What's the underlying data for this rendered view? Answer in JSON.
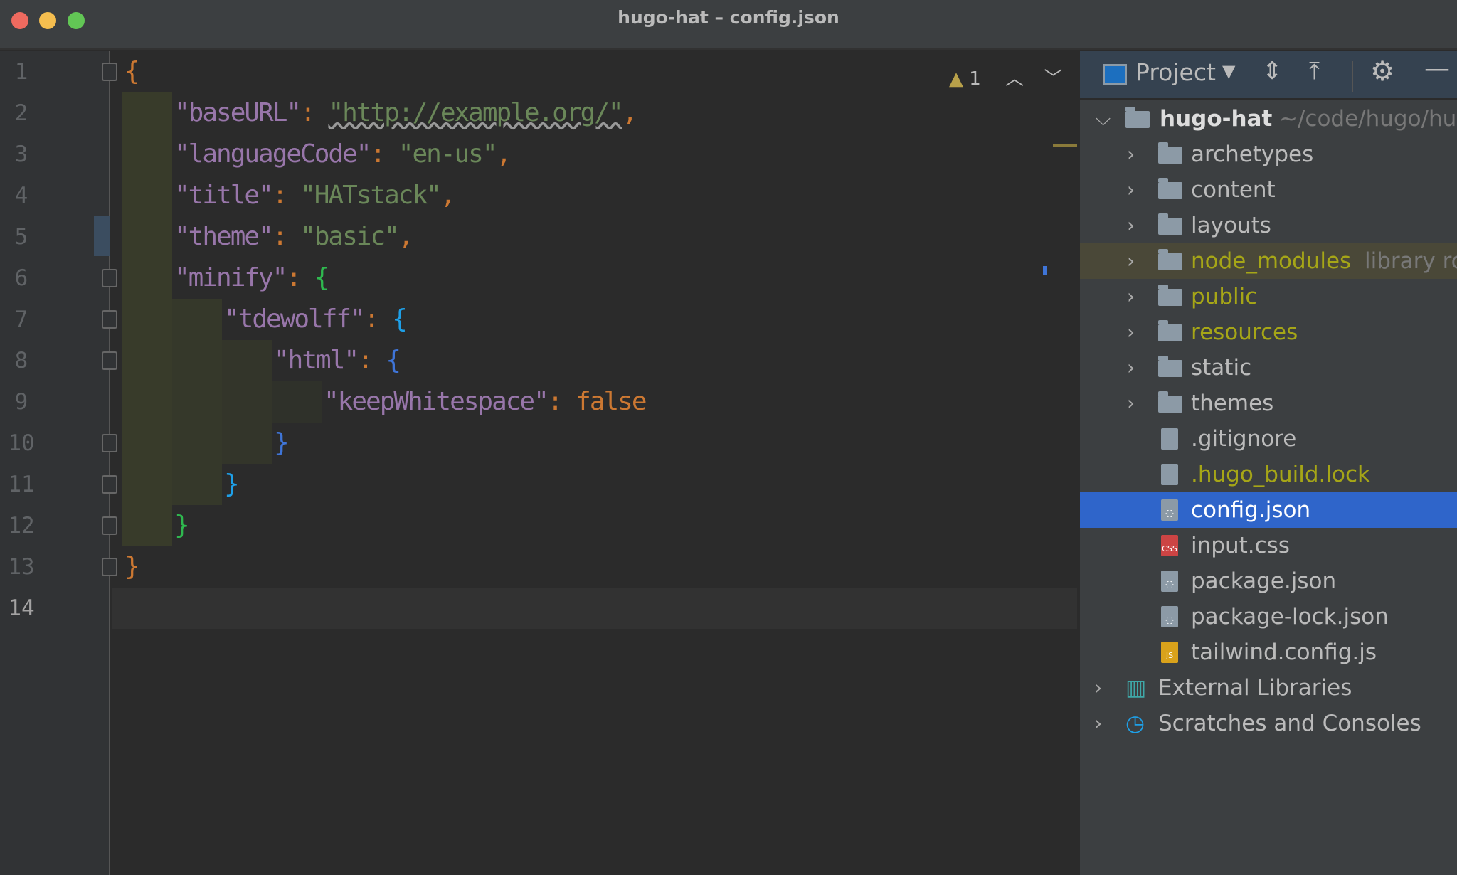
{
  "window": {
    "title": "hugo-hat – config.json"
  },
  "editor": {
    "warnings": "1",
    "lines": [
      {
        "n": "1",
        "parts": [
          [
            "b",
            "{"
          ]
        ]
      },
      {
        "n": "2",
        "parts": [
          [
            "k",
            "\"baseURL\""
          ],
          [
            "p",
            ": "
          ],
          [
            "s",
            "\"http://example.org/\""
          ],
          [
            "p",
            ","
          ]
        ]
      },
      {
        "n": "3",
        "parts": [
          [
            "k",
            "\"languageCode\""
          ],
          [
            "p",
            ": "
          ],
          [
            "s",
            "\"en-us\""
          ],
          [
            "p",
            ","
          ]
        ]
      },
      {
        "n": "4",
        "parts": [
          [
            "k",
            "\"title\""
          ],
          [
            "p",
            ": "
          ],
          [
            "s",
            "\"HATstack\""
          ],
          [
            "p",
            ","
          ]
        ]
      },
      {
        "n": "5",
        "parts": [
          [
            "k",
            "\"theme\""
          ],
          [
            "p",
            ": "
          ],
          [
            "s",
            "\"basic\""
          ],
          [
            "p",
            ","
          ]
        ]
      },
      {
        "n": "6",
        "parts": [
          [
            "k",
            "\"minify\""
          ],
          [
            "p",
            ": "
          ],
          [
            "g",
            "{"
          ]
        ]
      },
      {
        "n": "7",
        "parts": [
          [
            "k",
            "\"tdewolff\""
          ],
          [
            "p",
            ": "
          ],
          [
            "c",
            "{"
          ]
        ]
      },
      {
        "n": "8",
        "parts": [
          [
            "k",
            "\"html\""
          ],
          [
            "p",
            ": "
          ],
          [
            "bl",
            "{"
          ]
        ]
      },
      {
        "n": "9",
        "parts": [
          [
            "k",
            "\"keepWhitespace\""
          ],
          [
            "p",
            ": "
          ],
          [
            "b",
            "false"
          ]
        ]
      },
      {
        "n": "10",
        "parts": [
          [
            "bl",
            "}"
          ]
        ]
      },
      {
        "n": "11",
        "parts": [
          [
            "c",
            "}"
          ]
        ]
      },
      {
        "n": "12",
        "parts": [
          [
            "g",
            "}"
          ]
        ]
      },
      {
        "n": "13",
        "parts": [
          [
            "b",
            "}"
          ]
        ]
      },
      {
        "n": "14",
        "parts": []
      }
    ],
    "indents": [
      0,
      1,
      1,
      1,
      1,
      1,
      2,
      3,
      4,
      3,
      2,
      1,
      0,
      0
    ]
  },
  "project": {
    "title": "Project",
    "root": {
      "name": "hugo-hat",
      "path": "~/code/hugo/hu"
    },
    "items": [
      {
        "name": "archetypes",
        "type": "folder",
        "color": "normal"
      },
      {
        "name": "content",
        "type": "folder",
        "color": "normal"
      },
      {
        "name": "layouts",
        "type": "folder",
        "color": "normal"
      },
      {
        "name": "node_modules",
        "type": "folder",
        "color": "yellow",
        "note": "library ro",
        "lib": true
      },
      {
        "name": "public",
        "type": "folder",
        "color": "yellow"
      },
      {
        "name": "resources",
        "type": "folder",
        "color": "yellow"
      },
      {
        "name": "static",
        "type": "folder",
        "color": "normal"
      },
      {
        "name": "themes",
        "type": "folder",
        "color": "normal"
      },
      {
        "name": ".gitignore",
        "type": "file",
        "color": "normal"
      },
      {
        "name": ".hugo_build.lock",
        "type": "file",
        "color": "yellow"
      },
      {
        "name": "config.json",
        "type": "json",
        "color": "normal",
        "selected": true
      },
      {
        "name": "input.css",
        "type": "css",
        "color": "normal"
      },
      {
        "name": "package.json",
        "type": "json",
        "color": "normal"
      },
      {
        "name": "package-lock.json",
        "type": "json",
        "color": "normal"
      },
      {
        "name": "tailwind.config.js",
        "type": "js",
        "color": "normal"
      }
    ],
    "extras": [
      "External Libraries",
      "Scratches and Consoles"
    ]
  },
  "colors": {
    "selection": "#2f65ca",
    "keyword": "#9876aa",
    "string": "#6a8759",
    "punct": "#cc7832"
  }
}
